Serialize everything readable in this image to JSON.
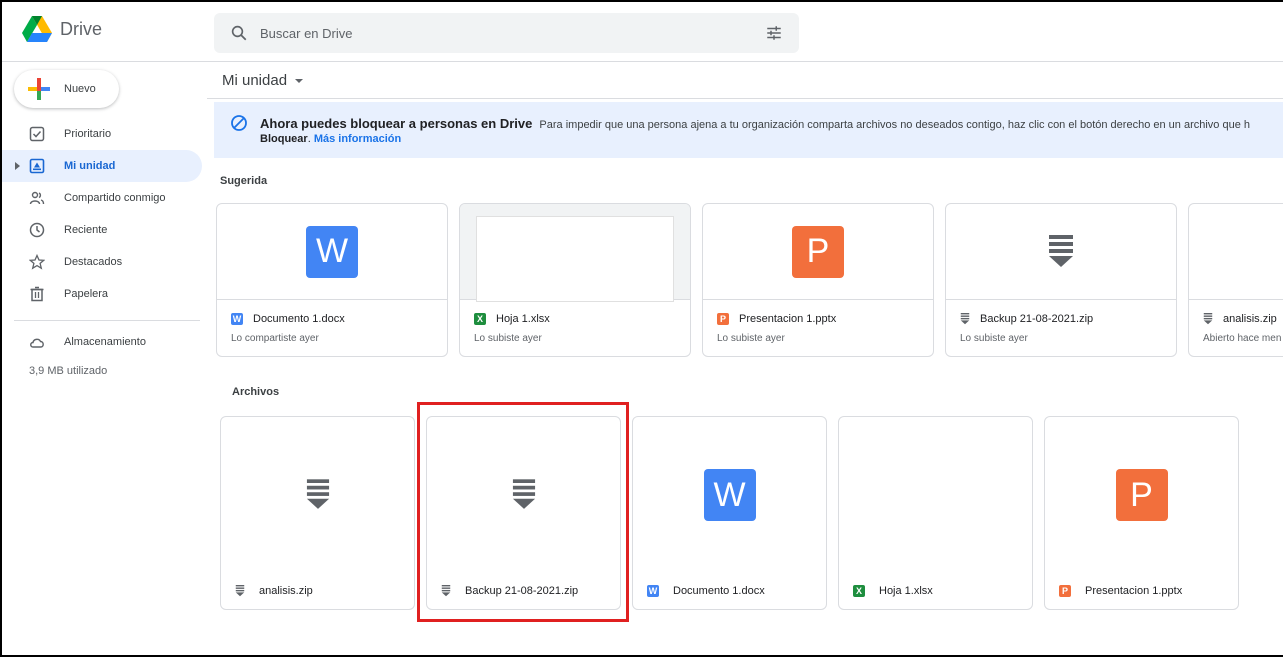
{
  "app": {
    "name": "Drive"
  },
  "search": {
    "placeholder": "Buscar en Drive"
  },
  "sidebar": {
    "new_label": "Nuevo",
    "items": [
      {
        "label": "Prioritario",
        "icon": "check-square-icon"
      },
      {
        "label": "Mi unidad",
        "icon": "drive-folder-icon",
        "active": true
      },
      {
        "label": "Compartido conmigo",
        "icon": "people-icon"
      },
      {
        "label": "Reciente",
        "icon": "clock-icon"
      },
      {
        "label": "Destacados",
        "icon": "star-icon"
      },
      {
        "label": "Papelera",
        "icon": "trash-icon"
      }
    ],
    "storage_label": "Almacenamiento",
    "storage_used": "3,9 MB utilizado"
  },
  "main": {
    "title": "Mi unidad",
    "banner": {
      "heading": "Ahora puedes bloquear a personas en Drive",
      "text": "Para impedir que una persona ajena a tu organización comparta archivos no deseados contigo, haz clic con el botón derecho en un archivo que h",
      "action": "Bloquear",
      "link": "Más información"
    },
    "suggested_label": "Sugerida",
    "suggested": [
      {
        "name": "Documento 1.docx",
        "sub": "Lo compartiste ayer",
        "type": "word"
      },
      {
        "name": "Hoja 1.xlsx",
        "sub": "Lo subiste ayer",
        "type": "sheet"
      },
      {
        "name": "Presentacion 1.pptx",
        "sub": "Lo subiste ayer",
        "type": "slides"
      },
      {
        "name": "Backup 21-08-2021.zip",
        "sub": "Lo subiste ayer",
        "type": "zip"
      },
      {
        "name": "analisis.zip",
        "sub": "Abierto hace men",
        "type": "zip"
      }
    ],
    "files_label": "Archivos",
    "files": [
      {
        "name": "analisis.zip",
        "type": "zip"
      },
      {
        "name": "Backup 21-08-2021.zip",
        "type": "zip",
        "highlighted": true
      },
      {
        "name": "Documento 1.docx",
        "type": "word"
      },
      {
        "name": "Hoja 1.xlsx",
        "type": "sheet"
      },
      {
        "name": "Presentacion 1.pptx",
        "type": "slides"
      }
    ],
    "icon_letters": {
      "word": "W",
      "sheet": "X",
      "slides": "P"
    }
  },
  "colors": {
    "highlight": "#e02020",
    "active_nav_bg": "#e8f0fe",
    "accent": "#1a73e8"
  }
}
